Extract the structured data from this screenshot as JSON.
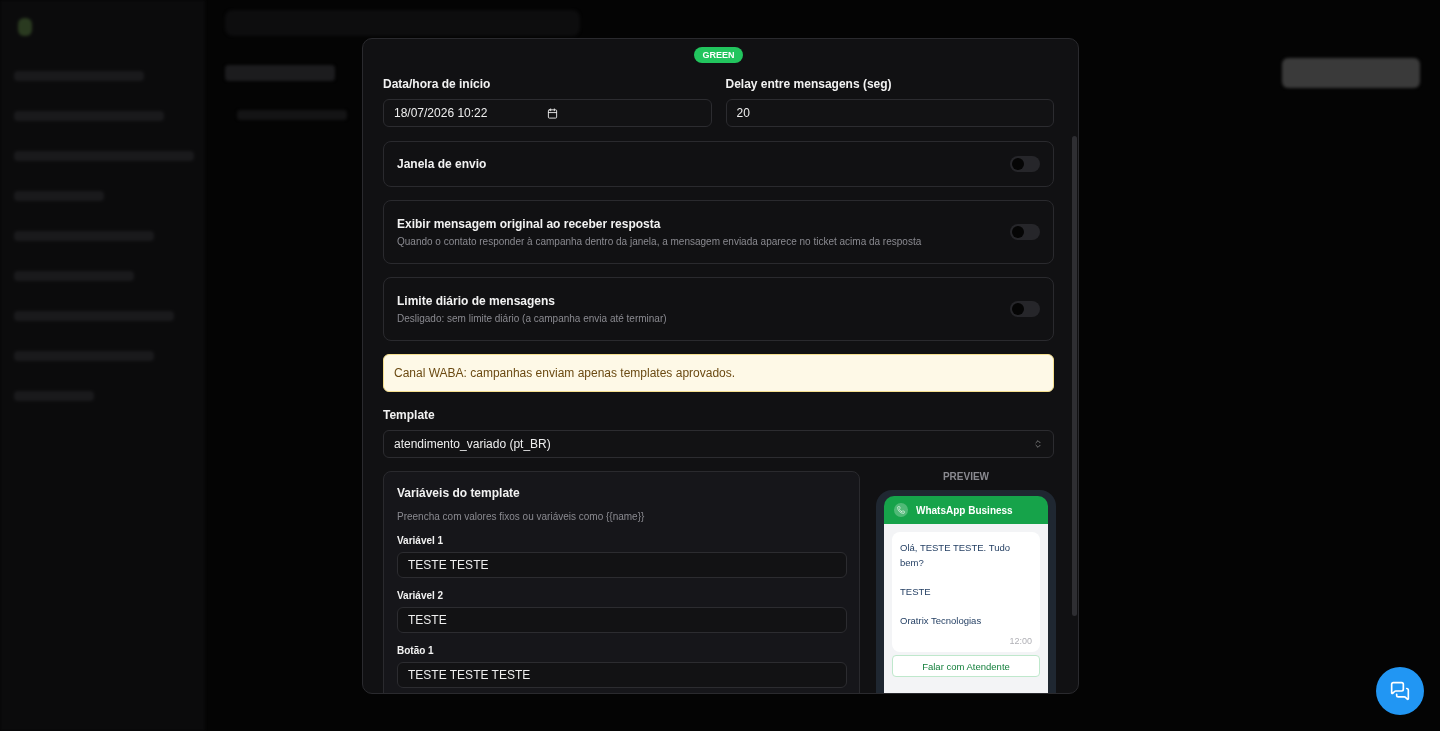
{
  "modal": {
    "status_badge": "GREEN",
    "start": {
      "label": "Data/hora de início",
      "value": "18/07/2026 10:22"
    },
    "delay": {
      "label": "Delay entre mensagens (seg)",
      "value": "20"
    },
    "toggles": [
      {
        "title": "Janela de envio",
        "on": false
      },
      {
        "title": "Exibir mensagem original ao receber resposta",
        "description": "Quando o contato responder à campanha dentro da janela, a mensagem enviada aparece no ticket acima da resposta",
        "on": false
      },
      {
        "title": "Limite diário de mensagens",
        "description": "Desligado: sem limite diário (a campanha envia até terminar)",
        "on": false
      }
    ],
    "notice": "Canal WABA: campanhas enviam apenas templates aprovados.",
    "template": {
      "label": "Template",
      "value": "atendimento_variado (pt_BR)"
    },
    "variables": {
      "title": "Variáveis do template",
      "hint": "Preencha com valores fixos ou variáveis como {{name}}",
      "fields": [
        {
          "label": "Variável 1",
          "value": "TESTE TESTE"
        },
        {
          "label": "Variável 2",
          "value": "TESTE"
        },
        {
          "label": "Botão 1",
          "value": "TESTE TESTE TESTE"
        }
      ]
    },
    "preview": {
      "label": "PREVIEW",
      "header": "WhatsApp Business",
      "message_lines": [
        "Olá, TESTE TESTE. Tudo bem?",
        "TESTE",
        "Oratrix Tecnologias"
      ],
      "time": "12:00",
      "button": "Falar com Atendente"
    }
  }
}
